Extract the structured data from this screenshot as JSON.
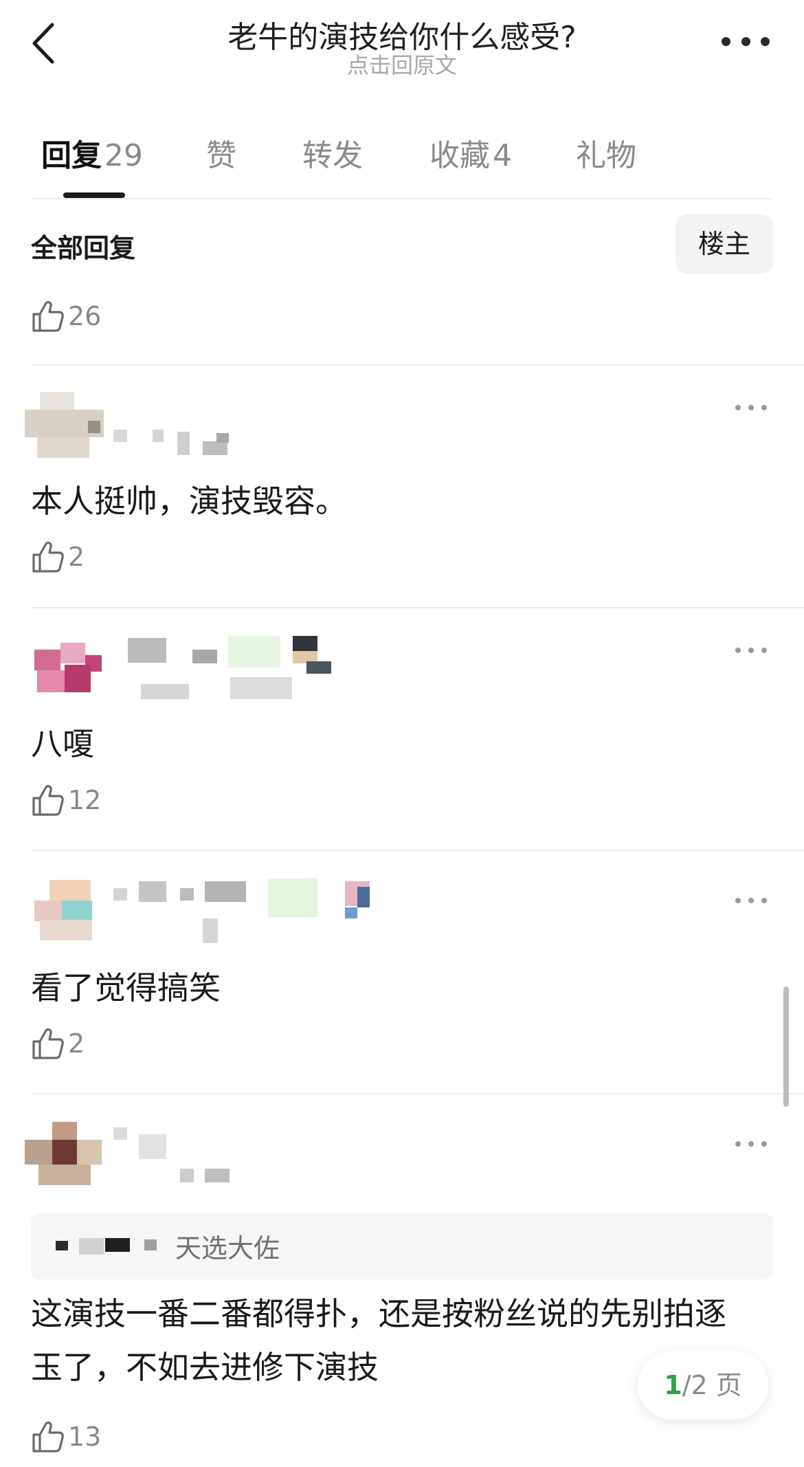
{
  "header": {
    "title": "老牛的演技给你什么感受?",
    "subtitle": "点击回原文"
  },
  "tabs": [
    {
      "label": "回复",
      "count": "29",
      "active": true
    },
    {
      "label": "赞",
      "count": "",
      "active": false
    },
    {
      "label": "转发",
      "count": "",
      "active": false
    },
    {
      "label": "收藏",
      "count": "4",
      "active": false
    },
    {
      "label": "礼物",
      "count": "",
      "active": false
    }
  ],
  "section": {
    "title": "全部回复",
    "host_button": "楼主"
  },
  "top_like": "26",
  "comments": [
    {
      "text": "本人挺帅，演技毁容。",
      "likes": "2"
    },
    {
      "text": "八嗄",
      "likes": "12"
    },
    {
      "text": "看了觉得搞笑",
      "likes": "2"
    },
    {
      "quote_name": "天选大佐",
      "text_line1": "这演技一番二番都得扑，还是按粉丝说的先别拍逐",
      "text_line2": "玉了，不如去进修下演技",
      "likes": "13"
    }
  ],
  "pager": {
    "current": "1",
    "total_text": "/2 页"
  },
  "colors": {
    "accent_green": "#2aa34a",
    "divider": "#ececec",
    "muted_text": "#8a8a8a"
  },
  "icons": [
    "back-arrow-icon",
    "more-dots-icon",
    "thumbs-up-icon"
  ]
}
